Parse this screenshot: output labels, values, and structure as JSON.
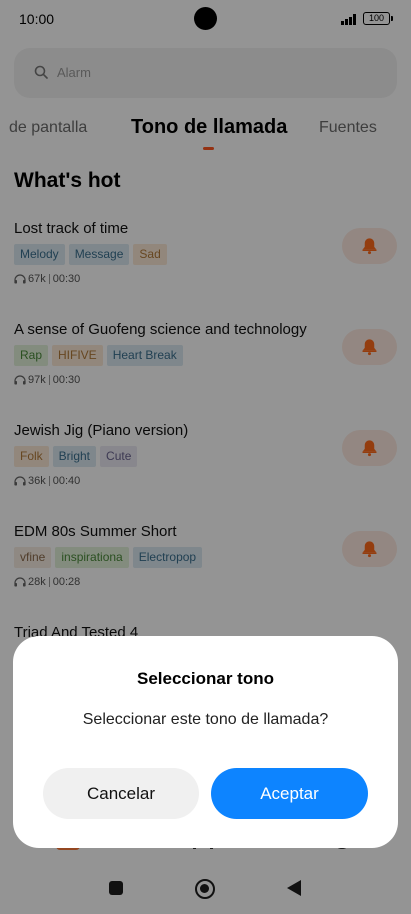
{
  "status_bar": {
    "time": "10:00",
    "battery": "100"
  },
  "search": {
    "placeholder": "Alarm"
  },
  "tabs": [
    {
      "label": "de pantalla"
    },
    {
      "label": "Tono de llamada",
      "active": true
    },
    {
      "label": "Fuentes"
    }
  ],
  "section": {
    "title": "What's hot"
  },
  "songs": [
    {
      "title": "Lost track of time",
      "tags": [
        {
          "label": "Melody",
          "color": "#dbe9f2",
          "text": "#3a6f8e"
        },
        {
          "label": "Message",
          "color": "#dbe9f2",
          "text": "#3a6f8e"
        },
        {
          "label": "Sad",
          "color": "#fbe9d6",
          "text": "#b27a3a"
        }
      ],
      "plays": "67k",
      "duration": "00:30"
    },
    {
      "title": "A sense of Guofeng science and technology",
      "tags": [
        {
          "label": "Rap",
          "color": "#e2f1da",
          "text": "#4a8a3a"
        },
        {
          "label": "HIFIVE",
          "color": "#fbe9d6",
          "text": "#b27a3a"
        },
        {
          "label": "Heart Break",
          "color": "#dbe9f2",
          "text": "#3a6f8e"
        }
      ],
      "plays": "97k",
      "duration": "00:30"
    },
    {
      "title": "Jewish Jig (Piano version)",
      "tags": [
        {
          "label": "Folk",
          "color": "#fbe9d6",
          "text": "#b27a3a"
        },
        {
          "label": "Bright",
          "color": "#dbe9f2",
          "text": "#3a6f8e"
        },
        {
          "label": "Cute",
          "color": "#ebe8f3",
          "text": "#6a6590"
        }
      ],
      "plays": "36k",
      "duration": "00:40"
    },
    {
      "title": "EDM 80s Summer Short",
      "tags": [
        {
          "label": "vfine",
          "color": "#f6ece2",
          "text": "#8a6a4a"
        },
        {
          "label": "inspirationa",
          "color": "#e2f1da",
          "text": "#4a8a3a"
        },
        {
          "label": "Electropop",
          "color": "#dbe9f2",
          "text": "#3a6f8e"
        }
      ],
      "plays": "28k",
      "duration": "00:28"
    },
    {
      "title": "Triad And Tested 4",
      "tags": [],
      "plays": "",
      "duration": ""
    }
  ],
  "dialog": {
    "title": "Seleccionar tono",
    "message": "Seleccionar este tono de llamada?",
    "cancel_label": "Cancelar",
    "accept_label": "Aceptar"
  },
  "colors": {
    "accent": "#ff5722",
    "primary_button": "#0d84ff",
    "bell": "#ff6a1a"
  }
}
